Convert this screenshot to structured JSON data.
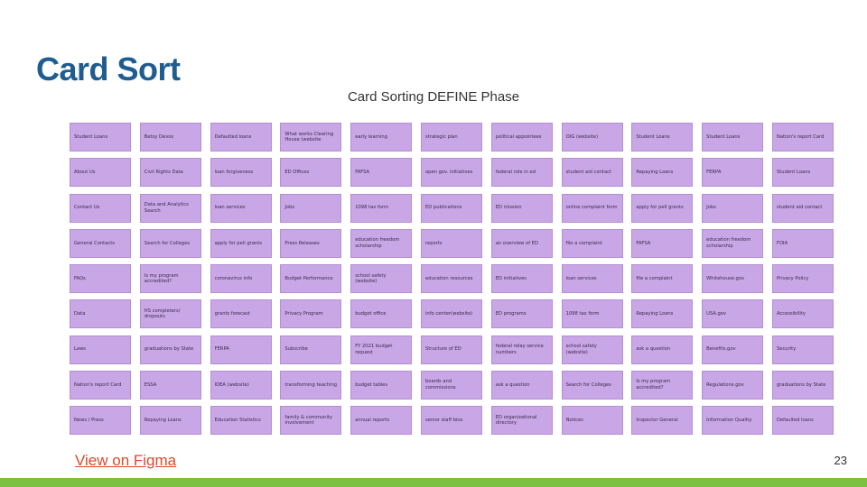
{
  "slide": {
    "title": "Card Sort",
    "board_heading": "Card Sorting DEFINE Phase",
    "link_label": "View on Figma",
    "page_number": "23"
  },
  "colors": {
    "title": "#1f5d91",
    "card": "#c9a6e6",
    "link": "#e0472a",
    "bottom_bar": "#7dc142"
  },
  "cards": [
    [
      "Student Loans",
      "Betsy Devos",
      "Defaulted loans",
      "What works Clearing House (website",
      "early learning",
      "strategic plan",
      "political appointees",
      "OIG (website)",
      "Student Loans",
      "Student Loans",
      "Nation's report Card"
    ],
    [
      "About Us",
      "Civil Rights Data",
      "loan forgiveness",
      "ED Offices",
      "FAFSA",
      "open gov. initiatives",
      "federal role in ed",
      "student aid contact",
      "Repaying Loans",
      "FERPA",
      "Student Loans"
    ],
    [
      "Contact Us",
      "Data and Analytics Search",
      "loan services",
      "Jobs",
      "1098 tax form",
      "ED publications",
      "ED mission",
      "online complaint form",
      "apply for pell grants",
      "Jobs",
      "student aid contact"
    ],
    [
      "General Contacts",
      "Search for Colleges",
      "apply for pell grants",
      "Press Releases",
      "education freedom scholarship",
      "reports",
      "an overview of ED",
      "file a complaint",
      "FAFSA",
      "education freedom scholarship",
      "FOIA"
    ],
    [
      "FAQs",
      "Is my program accredited?",
      "coronavirus info",
      "Budget Performance",
      "school safety (website)",
      "education resources",
      "ED initiatives",
      "loan services",
      "file a complaint",
      "Whitehouse.gov",
      "Privacy Policy"
    ],
    [
      "Data",
      "HS completers/ dropouts",
      "grants forecast",
      "Privacy Program",
      "budget office",
      "info center(website)",
      "ED programs",
      "1098 tax form",
      "Repaying Loans",
      "USA.gov",
      "Accessibility"
    ],
    [
      "Laws",
      "graduations by State",
      "FERPA",
      "Subscribe",
      "FY 2021 budget request",
      "Structure of ED",
      "federal relay service numbers",
      "school safety (website)",
      "ask a question",
      "Benefits.gov",
      "Security"
    ],
    [
      "Nation's report Card",
      "ESSA",
      "IDEA (website)",
      "transforming teaching",
      "budget tables",
      "boards and commissions",
      "ask a question",
      "Search for Colleges",
      "Is my program accredited?",
      "Regulations.gov",
      "graduations by State"
    ],
    [
      "News / Press",
      "Repaying Loans",
      "Education Statistics",
      "family & community involvement",
      "annual reports",
      "senior staff bios",
      "ED organizational directory",
      "Notices",
      "Inspector General",
      "Information Quality",
      "Defaulted loans"
    ]
  ]
}
